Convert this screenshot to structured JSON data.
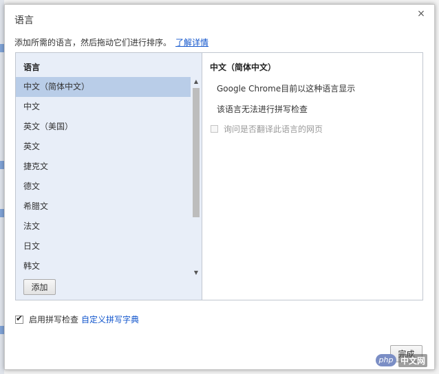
{
  "dialog": {
    "title": "语言",
    "close_glyph": "×",
    "instructions": "添加所需的语言，然后拖动它们进行排序。",
    "learn_more": "了解详情"
  },
  "language_list": {
    "header": "语言",
    "items": [
      {
        "label": "中文（简体中文）",
        "selected": true
      },
      {
        "label": "中文",
        "selected": false
      },
      {
        "label": "英文（美国）",
        "selected": false
      },
      {
        "label": "英文",
        "selected": false
      },
      {
        "label": "捷克文",
        "selected": false
      },
      {
        "label": "德文",
        "selected": false
      },
      {
        "label": "希腊文",
        "selected": false
      },
      {
        "label": "法文",
        "selected": false
      },
      {
        "label": "日文",
        "selected": false
      },
      {
        "label": "韩文",
        "selected": false
      }
    ],
    "add_button": "添加",
    "scroll_up_glyph": "▲",
    "scroll_down_glyph": "▼"
  },
  "detail": {
    "title": "中文（简体中文）",
    "display_info": "Google Chrome目前以这种语言显示",
    "spellcheck_info": "该语言无法进行拼写检查",
    "translate_prompt": "询问是否翻译此语言的网页",
    "translate_checked": false
  },
  "spellcheck": {
    "label": "启用拼写检查",
    "checked": true,
    "check_glyph": "✔",
    "custom_dictionary": "自定义拼写字典"
  },
  "footer": {
    "done_button": "完成"
  },
  "watermark": {
    "logo": "php",
    "text": "中文网"
  },
  "colors": {
    "list_background": "#e8eef8",
    "selected_item": "#b9cde8",
    "link": "#1155cc"
  }
}
